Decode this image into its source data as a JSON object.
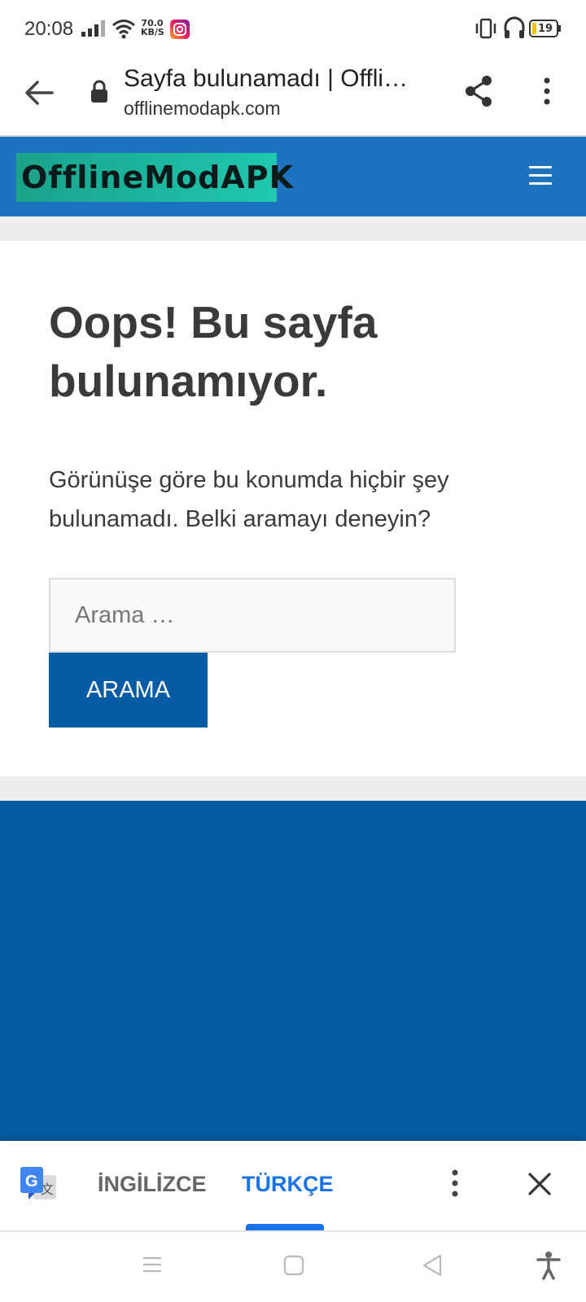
{
  "status_bar": {
    "time": "20:08",
    "speed_value": "70.0",
    "speed_unit": "KB/S",
    "battery": "19"
  },
  "browser": {
    "page_title": "Sayfa bulunamadı | Offli…",
    "url": "offlinemodapk.com"
  },
  "site": {
    "logo": "OfflineModAPK"
  },
  "content": {
    "heading": "Oops! Bu sayfa bulunamıyor.",
    "description": "Görünüşe göre bu konumda hiçbir şey bulunamadı. Belki aramayı deneyin?",
    "search_placeholder": "Arama …",
    "search_button": "ARAMA"
  },
  "translate_bar": {
    "source_language": "İNGİLİZCE",
    "target_language": "TÜRKÇE"
  },
  "colors": {
    "header_blue": "#1e73be",
    "button_blue": "#055ca4",
    "logo_teal": "#1fc8b0",
    "translate_accent": "#1a73e8"
  }
}
